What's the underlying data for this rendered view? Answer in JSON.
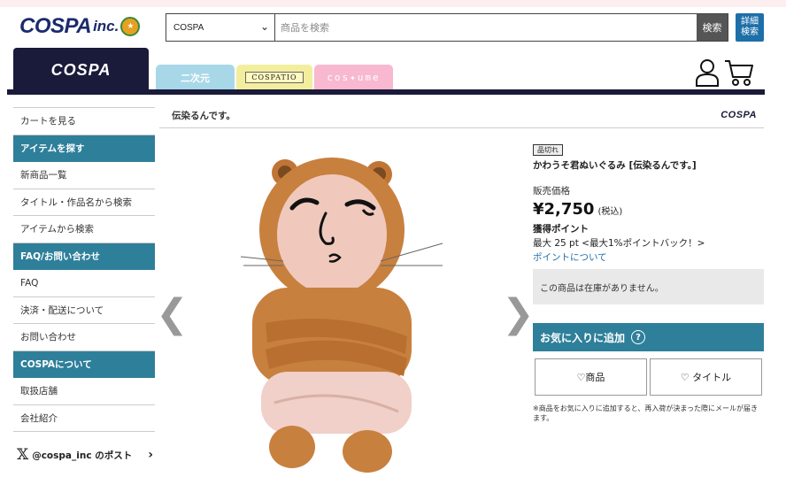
{
  "header": {
    "logo_text": "COSPA",
    "logo_suffix": "inc.",
    "search_scope": "COSPA",
    "search_placeholder": "商品を検索",
    "search_button": "検索",
    "advanced_search": "詳細\n検索"
  },
  "nav": {
    "tabs": [
      {
        "label": "COSPA"
      },
      {
        "label": "二次元"
      },
      {
        "label": "COSPATIO"
      },
      {
        "label": "cos✦ume"
      }
    ]
  },
  "sidebar": {
    "items": [
      {
        "type": "item",
        "label": "カートを見る"
      },
      {
        "type": "head",
        "label": "アイテムを探す"
      },
      {
        "type": "item",
        "label": "新商品一覧"
      },
      {
        "type": "item",
        "label": "タイトル・作品名から検索"
      },
      {
        "type": "item",
        "label": "アイテムから検索"
      },
      {
        "type": "head",
        "label": "FAQ/お問い合わせ"
      },
      {
        "type": "item",
        "label": "FAQ"
      },
      {
        "type": "item",
        "label": "決済・配送について"
      },
      {
        "type": "item",
        "label": "お問い合わせ"
      },
      {
        "type": "head",
        "label": "COSPAについて"
      },
      {
        "type": "item",
        "label": "取扱店舗"
      },
      {
        "type": "item",
        "label": "会社紹介"
      }
    ],
    "x_label": "@cospa_inc のポスト",
    "x_logo": "𝕏"
  },
  "main": {
    "breadcrumb": "伝染るんです。",
    "breadcrumb_logo": "COSPA",
    "prev_arrow": "❮",
    "next_arrow": "❯"
  },
  "product": {
    "status": "品切れ",
    "name": "かわうそ君ぬいぐるみ [伝染るんです。]",
    "price_label": "販売価格",
    "price": "¥2,750",
    "tax": "(税込)",
    "points_title": "獲得ポイント",
    "points": "最大 25 pt <最大1%ポイントバック！>",
    "points_link": "ポイントについて",
    "stock_message": "この商品は在庫がありません。",
    "favorite_head": "お気に入りに追加",
    "favorite_help": "?",
    "fav_item_label": "♡商品",
    "fav_title_label": "♡ タイトル",
    "note": "※商品をお気に入りに追加すると、再入荷が決まった際にメールが届きます。"
  }
}
